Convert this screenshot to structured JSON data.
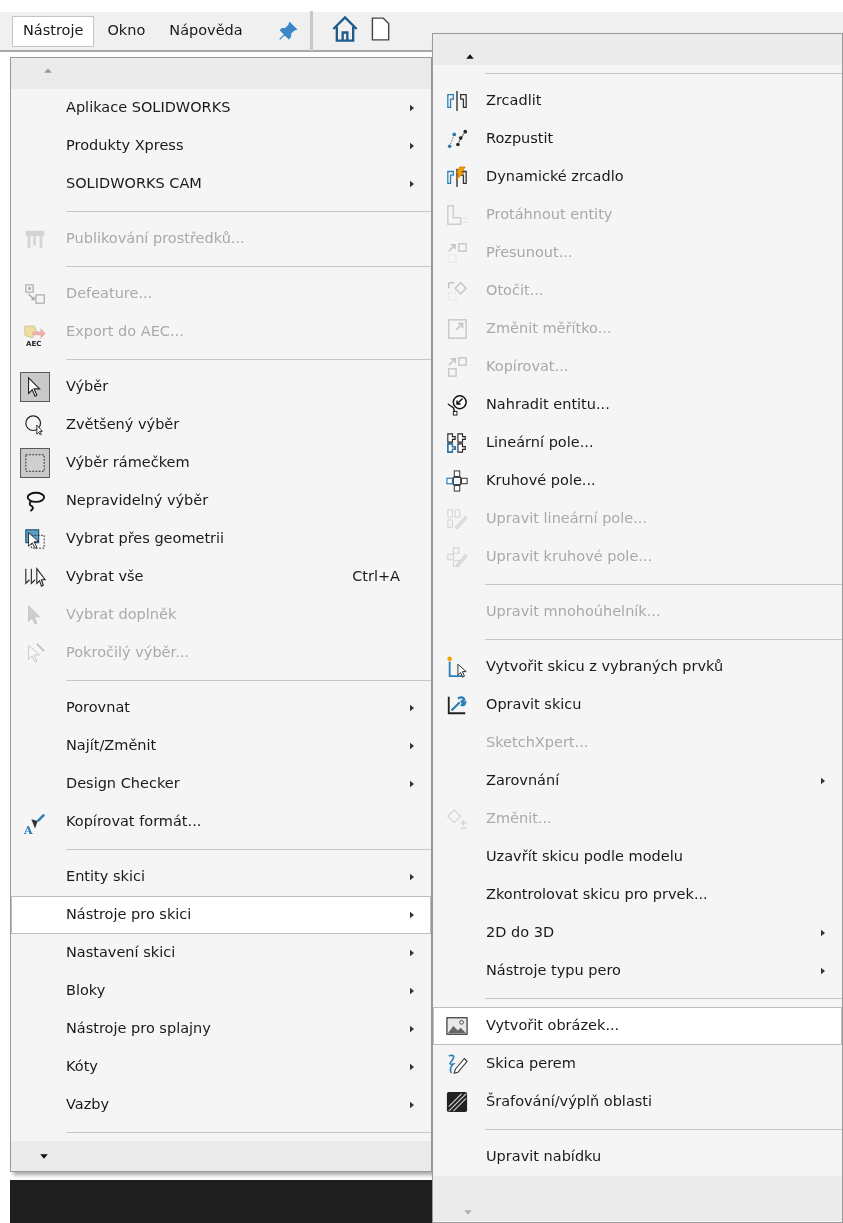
{
  "menubar": [
    {
      "label": "Nástroje",
      "selected": true
    },
    {
      "label": "Okno",
      "selected": false
    },
    {
      "label": "Nápověda",
      "selected": false
    }
  ],
  "main_menu": {
    "items": [
      {
        "kind": "item",
        "label": "Aplikace SOLIDWORKS",
        "disabled": false,
        "submenu": true,
        "selected": false,
        "checked": false
      },
      {
        "kind": "item",
        "label": "Produkty Xpress",
        "disabled": false,
        "submenu": true,
        "selected": false,
        "checked": false
      },
      {
        "kind": "item",
        "label": "SOLIDWORKS CAM",
        "disabled": false,
        "submenu": true,
        "selected": false,
        "checked": false
      },
      {
        "kind": "separator"
      },
      {
        "kind": "item",
        "label": "Publikování prostředků...",
        "disabled": true,
        "submenu": false,
        "selected": false,
        "checked": false
      },
      {
        "kind": "separator"
      },
      {
        "kind": "item",
        "label": "Defeature...",
        "disabled": true,
        "submenu": false,
        "selected": false,
        "checked": false
      },
      {
        "kind": "item",
        "label": "Export do AEC...",
        "disabled": true,
        "submenu": false,
        "selected": false,
        "checked": false,
        "icon_label": "AEC"
      },
      {
        "kind": "separator"
      },
      {
        "kind": "item",
        "label": "Výběr",
        "disabled": false,
        "submenu": false,
        "selected": false,
        "checked": true
      },
      {
        "kind": "item",
        "label": "Zvětšený výběr",
        "disabled": false,
        "submenu": false,
        "selected": false,
        "checked": false
      },
      {
        "kind": "item",
        "label": "Výběr rámečkem",
        "disabled": false,
        "submenu": false,
        "selected": false,
        "checked": true
      },
      {
        "kind": "item",
        "label": "Nepravidelný výběr",
        "disabled": false,
        "submenu": false,
        "selected": false,
        "checked": false
      },
      {
        "kind": "item",
        "label": "Vybrat přes geometrii",
        "disabled": false,
        "submenu": false,
        "selected": false,
        "checked": false
      },
      {
        "kind": "item",
        "label": "Vybrat vše",
        "shortcut": "Ctrl+A",
        "disabled": false,
        "submenu": false,
        "selected": false,
        "checked": false
      },
      {
        "kind": "item",
        "label": "Vybrat doplněk",
        "disabled": true,
        "submenu": false,
        "selected": false,
        "checked": false
      },
      {
        "kind": "item",
        "label": "Pokročilý výběr...",
        "disabled": true,
        "submenu": false,
        "selected": false,
        "checked": false
      },
      {
        "kind": "separator"
      },
      {
        "kind": "item",
        "label": "Porovnat",
        "disabled": false,
        "submenu": true,
        "selected": false,
        "checked": false
      },
      {
        "kind": "item",
        "label": "Najít/Změnit",
        "disabled": false,
        "submenu": true,
        "selected": false,
        "checked": false
      },
      {
        "kind": "item",
        "label": "Design Checker",
        "disabled": false,
        "submenu": true,
        "selected": false,
        "checked": false
      },
      {
        "kind": "item",
        "label": "Kopírovat formát...",
        "disabled": false,
        "submenu": false,
        "selected": false,
        "checked": false,
        "icon_label": "A"
      },
      {
        "kind": "separator"
      },
      {
        "kind": "item",
        "label": "Entity skici",
        "disabled": false,
        "submenu": true,
        "selected": false,
        "checked": false
      },
      {
        "kind": "item",
        "label": "Nástroje pro skici",
        "disabled": false,
        "submenu": true,
        "selected": true,
        "checked": false
      },
      {
        "kind": "item",
        "label": "Nastavení skici",
        "disabled": false,
        "submenu": true,
        "selected": false,
        "checked": false
      },
      {
        "kind": "item",
        "label": "Bloky",
        "disabled": false,
        "submenu": true,
        "selected": false,
        "checked": false
      },
      {
        "kind": "item",
        "label": "Nástroje pro splajny",
        "disabled": false,
        "submenu": true,
        "selected": false,
        "checked": false
      },
      {
        "kind": "item",
        "label": "Kóty",
        "disabled": false,
        "submenu": true,
        "selected": false,
        "checked": false
      },
      {
        "kind": "item",
        "label": "Vazby",
        "disabled": false,
        "submenu": true,
        "selected": false,
        "checked": false
      },
      {
        "kind": "separator"
      }
    ]
  },
  "submenu": {
    "items": [
      {
        "kind": "separator"
      },
      {
        "kind": "item",
        "label": "Zrcadlit",
        "disabled": false,
        "submenu": false,
        "selected": false
      },
      {
        "kind": "item",
        "label": "Rozpustit",
        "disabled": false,
        "submenu": false,
        "selected": false
      },
      {
        "kind": "item",
        "label": "Dynamické zrcadlo",
        "disabled": false,
        "submenu": false,
        "selected": false
      },
      {
        "kind": "item",
        "label": "Protáhnout entity",
        "disabled": true,
        "submenu": false,
        "selected": false
      },
      {
        "kind": "item",
        "label": "Přesunout...",
        "disabled": true,
        "submenu": false,
        "selected": false
      },
      {
        "kind": "item",
        "label": "Otočit...",
        "disabled": true,
        "submenu": false,
        "selected": false
      },
      {
        "kind": "item",
        "label": "Změnit měřítko...",
        "disabled": true,
        "submenu": false,
        "selected": false
      },
      {
        "kind": "item",
        "label": "Kopírovat...",
        "disabled": true,
        "submenu": false,
        "selected": false
      },
      {
        "kind": "item",
        "label": "Nahradit entitu...",
        "disabled": false,
        "submenu": false,
        "selected": false
      },
      {
        "kind": "item",
        "label": "Lineární pole...",
        "disabled": false,
        "submenu": false,
        "selected": false
      },
      {
        "kind": "item",
        "label": "Kruhové pole...",
        "disabled": false,
        "submenu": false,
        "selected": false
      },
      {
        "kind": "item",
        "label": "Upravit lineární pole...",
        "disabled": true,
        "submenu": false,
        "selected": false
      },
      {
        "kind": "item",
        "label": "Upravit kruhové pole...",
        "disabled": true,
        "submenu": false,
        "selected": false
      },
      {
        "kind": "separator"
      },
      {
        "kind": "item",
        "label": "Upravit mnohoúhelník...",
        "disabled": true,
        "submenu": false,
        "selected": false
      },
      {
        "kind": "separator"
      },
      {
        "kind": "item",
        "label": "Vytvořit skicu z vybraných prvků",
        "disabled": false,
        "submenu": false,
        "selected": false
      },
      {
        "kind": "item",
        "label": "Opravit skicu",
        "disabled": false,
        "submenu": false,
        "selected": false
      },
      {
        "kind": "item",
        "label": "SketchXpert...",
        "disabled": true,
        "submenu": false,
        "selected": false
      },
      {
        "kind": "item",
        "label": "Zarovnání",
        "disabled": false,
        "submenu": true,
        "selected": false
      },
      {
        "kind": "item",
        "label": "Změnit...",
        "disabled": true,
        "submenu": false,
        "selected": false
      },
      {
        "kind": "item",
        "label": "Uzavřít skicu podle modelu",
        "disabled": false,
        "submenu": false,
        "selected": false
      },
      {
        "kind": "item",
        "label": "Zkontrolovat skicu pro prvek...",
        "disabled": false,
        "submenu": false,
        "selected": false
      },
      {
        "kind": "item",
        "label": "2D do 3D",
        "disabled": false,
        "submenu": true,
        "selected": false
      },
      {
        "kind": "item",
        "label": "Nástroje typu pero",
        "disabled": false,
        "submenu": true,
        "selected": false
      },
      {
        "kind": "separator"
      },
      {
        "kind": "item",
        "label": "Vytvořit obrázek...",
        "disabled": false,
        "submenu": false,
        "selected": true
      },
      {
        "kind": "item",
        "label": "Skica perem",
        "disabled": false,
        "submenu": false,
        "selected": false
      },
      {
        "kind": "item",
        "label": "Šrafování/výplň oblasti",
        "disabled": false,
        "submenu": false,
        "selected": false
      },
      {
        "kind": "separator"
      },
      {
        "kind": "item",
        "label": "Upravit nabídku",
        "disabled": false,
        "submenu": false,
        "selected": false
      }
    ]
  }
}
